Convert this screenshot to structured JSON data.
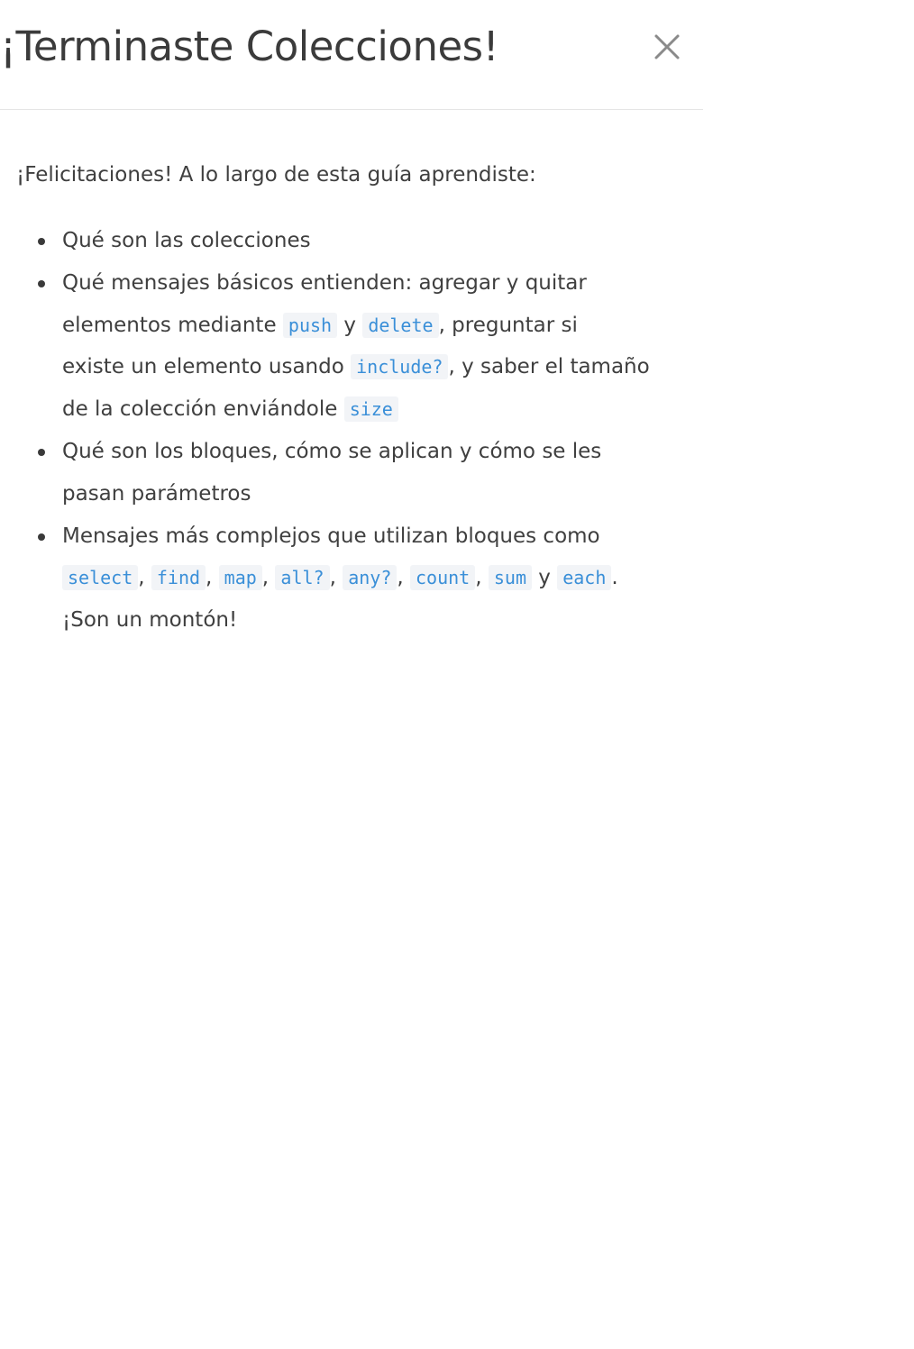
{
  "modal": {
    "title": "¡Terminaste Colecciones!",
    "close_icon": "close-icon"
  },
  "body": {
    "intro": "¡Felicitaciones! A lo largo de esta guía aprendiste:",
    "items": {
      "i1": {
        "text": "Qué son las colecciones"
      },
      "i2": {
        "l1": "Qué mensajes básicos entienden: agregar y quitar",
        "l2a": "elementos mediante ",
        "c_push": "push",
        "l2b": " y ",
        "c_delete": "delete",
        "l2c": ", preguntar si",
        "l3a": "existe un elemento usando ",
        "c_include": "include?",
        "l3b": ", y saber el tamaño",
        "l4a": "de la colección enviándole ",
        "c_size": "size"
      },
      "i3": {
        "l1": "Qué son los bloques, cómo se aplican y cómo se les",
        "l2": "pasan parámetros"
      },
      "i4": {
        "l1": "Mensajes más complejos que utilizan bloques como",
        "c_select": "select",
        "sep1": ", ",
        "c_find": "find",
        "sep2": ", ",
        "c_map": "map",
        "sep3": ", ",
        "c_all": "all?",
        "sep4": ", ",
        "c_any": "any?",
        "sep5": ", ",
        "c_count": "count",
        "sep6": ", ",
        "c_sum": "sum",
        "sep7": " y ",
        "c_each": "each",
        "end": ".",
        "l3": "¡Son un montón!"
      }
    }
  }
}
